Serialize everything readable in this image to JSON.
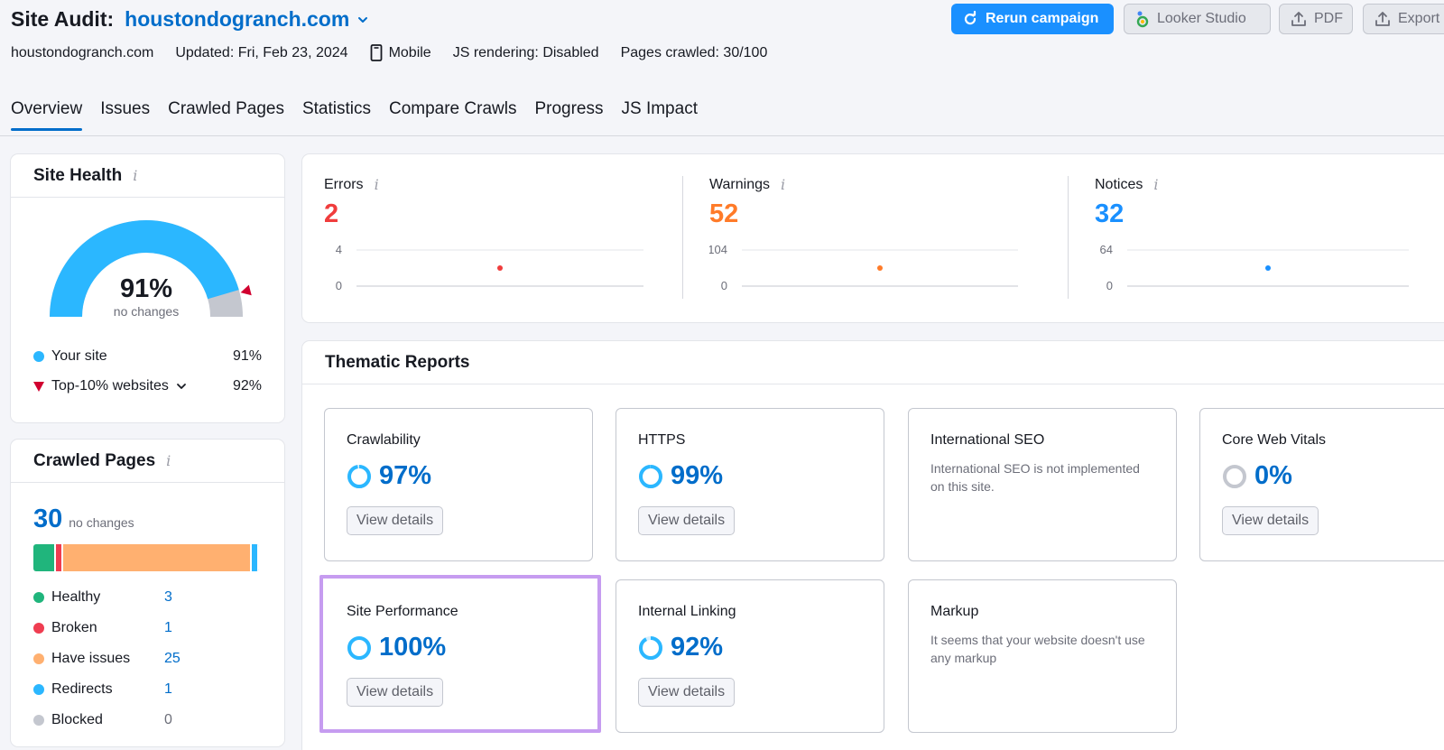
{
  "header": {
    "title_prefix": "Site Audit:",
    "domain": "houstondogranch.com",
    "buttons": {
      "rerun": "Rerun campaign",
      "looker": "Looker Studio",
      "pdf": "PDF",
      "export": "Export"
    },
    "meta": {
      "domain": "houstondogranch.com",
      "updated": "Updated: Fri, Feb 23, 2024",
      "device": "Mobile",
      "js_rendering": "JS rendering: Disabled",
      "pages_crawled": "Pages crawled: 30/100"
    }
  },
  "tabs": [
    "Overview",
    "Issues",
    "Crawled Pages",
    "Statistics",
    "Compare Crawls",
    "Progress",
    "JS Impact"
  ],
  "site_health": {
    "title": "Site Health",
    "value": "91%",
    "value_num": 91,
    "subtext": "no changes",
    "top10_num": 92,
    "legend": [
      {
        "label": "Your site",
        "value": "91%",
        "color": "#2bb7ff"
      },
      {
        "label": "Top-10% websites",
        "value": "92%",
        "color": "#d1002f"
      }
    ]
  },
  "crawled_pages": {
    "title": "Crawled Pages",
    "total": "30",
    "subtext": "no changes",
    "rows": [
      {
        "label": "Healthy",
        "count": "3",
        "value": 3,
        "color": "#20b57c",
        "link": true
      },
      {
        "label": "Broken",
        "count": "1",
        "value": 1,
        "color": "#ef3d51",
        "link": true
      },
      {
        "label": "Have issues",
        "count": "25",
        "value": 25,
        "color": "#ffb070",
        "link": true
      },
      {
        "label": "Redirects",
        "count": "1",
        "value": 1,
        "color": "#2bb7ff",
        "link": true
      },
      {
        "label": "Blocked",
        "count": "0",
        "value": 0,
        "color": "#c4c7cf",
        "link": false
      }
    ]
  },
  "summary": {
    "errors": {
      "label": "Errors",
      "value": "2",
      "color": "#f03d3d",
      "y_top": "4",
      "y_bottom": "0",
      "point": 2,
      "ymax": 4
    },
    "warnings": {
      "label": "Warnings",
      "value": "52",
      "color": "#ff7b29",
      "y_top": "104",
      "y_bottom": "0",
      "point": 52,
      "ymax": 104
    },
    "notices": {
      "label": "Notices",
      "value": "32",
      "color": "#1a90ff",
      "y_top": "64",
      "y_bottom": "0",
      "point": 32,
      "ymax": 64
    }
  },
  "thematic": {
    "title": "Thematic Reports",
    "view_details": "View details",
    "reports": [
      {
        "name": "Crawlability",
        "score": "97%",
        "pct": 97
      },
      {
        "name": "HTTPS",
        "score": "99%",
        "pct": 99
      },
      {
        "name": "International SEO",
        "text": "International SEO is not implemented on this site."
      },
      {
        "name": "Core Web Vitals",
        "score": "0%",
        "pct": 0
      },
      {
        "name": "Site Performance",
        "score": "100%",
        "pct": 100
      },
      {
        "name": "Internal Linking",
        "score": "92%",
        "pct": 92
      },
      {
        "name": "Markup",
        "text": "It seems that your website doesn't use any markup"
      }
    ]
  }
}
